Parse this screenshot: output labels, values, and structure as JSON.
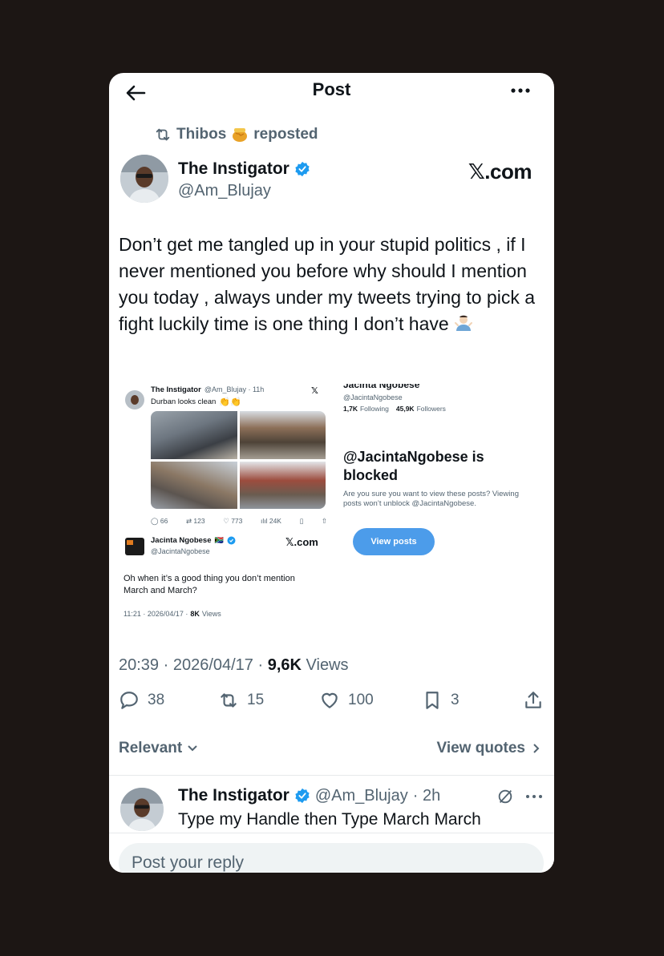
{
  "header": {
    "title": "Post"
  },
  "repost": {
    "user": "Thibos",
    "label": "reposted"
  },
  "author": {
    "name": "The Instigator",
    "handle": "@Am_Blujay",
    "brand": "𝕏.com"
  },
  "tweet": {
    "text": "Don’t get me tangled up in your stupid politics , if I never mentioned you before why should I mention you today , always under my tweets trying to pick a fight luckily time is one thing I don’t have"
  },
  "embed": {
    "top_author": "The Instigator",
    "top_handle_time": "@Am_Blujay · 11h",
    "top_text": "Durban looks clean",
    "stats": [
      "66",
      "123",
      "773",
      "24K"
    ],
    "reply_author": "Jacinta Ngobese",
    "reply_handle": "@JacintaNgobese",
    "brand": "𝕏.com",
    "reply_text": "Oh when it’s a good thing you don’t mention March and March?",
    "reply_time": "11:21 · 2026/04/17 ·",
    "reply_views": "8K",
    "reply_views_label": "Views",
    "right_name": "Jacinta Ngobese",
    "right_handle": "@JacintaNgobese",
    "following_count": "1,7K",
    "following_label": "Following",
    "followers_count": "45,9K",
    "followers_label": "Followers",
    "blocked_title": "@JacintaNgobese is blocked",
    "blocked_text": "Are you sure you want to view these posts? Viewing posts won’t unblock @JacintaNgobese.",
    "view_posts": "View posts"
  },
  "meta": {
    "time": "20:39 · 2026/04/17 ·",
    "views_count": "9,6K",
    "views_label": "Views"
  },
  "actions": {
    "replies": "38",
    "reposts": "15",
    "likes": "100",
    "bookmarks": "3"
  },
  "sort": {
    "relevant": "Relevant",
    "view_quotes": "View quotes"
  },
  "reply": {
    "name": "The Instigator",
    "handle": "@Am_Blujay",
    "time": "· 2h",
    "text": "Type my Handle then Type March March"
  },
  "composer": {
    "placeholder": "Post your reply"
  },
  "colors": {
    "accent": "#1d9bf0",
    "text": "#0f1419",
    "muted": "#536471"
  }
}
